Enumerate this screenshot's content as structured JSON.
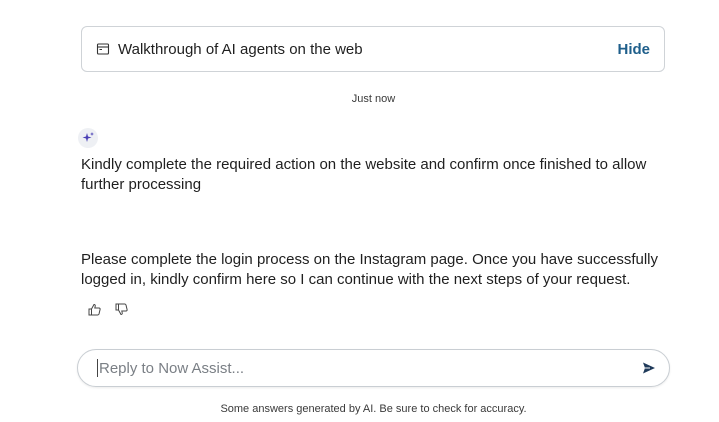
{
  "walkthrough": {
    "title": "Walkthrough of AI agents on the web",
    "hide_label": "Hide"
  },
  "timestamp": "Just now",
  "assistant": {
    "avatar_icon": "sparkle-icon",
    "messages": [
      "Kindly complete the required action on the website and confirm once finished to allow further processing",
      "Please complete the login process on the Instagram page. Once you have successfully logged in, kindly confirm here so I can continue with the next steps of your request."
    ]
  },
  "feedback": {
    "up_icon": "thumbs-up-icon",
    "down_icon": "thumbs-down-icon"
  },
  "composer": {
    "placeholder": "Reply to Now Assist...",
    "value": "",
    "send_icon": "send-icon"
  },
  "disclaimer": "Some answers generated by AI. Be sure to check for accuracy.",
  "colors": {
    "hide_link": "#1f5f8b",
    "sparkle": "#4a3fb5",
    "border": "#cfd3d7"
  }
}
